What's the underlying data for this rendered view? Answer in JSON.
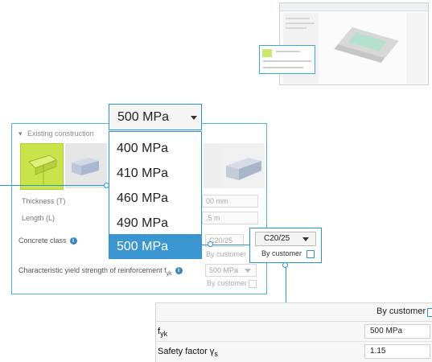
{
  "section": {
    "title": "Existing construction"
  },
  "fields": {
    "thickness_label": "Thickness (T)",
    "thickness_value": "00 mm",
    "length_label": "Length (L)",
    "length_value": ".5 m",
    "concrete_label": "Concrete class",
    "concrete_value": "C20/25",
    "concrete_by_customer": "By customer",
    "fyk_label_main": "Characteristic yield strength of reinforcement f",
    "fyk_label_sub": "yk",
    "fyk_value": "500 MPa",
    "fyk_by_customer": "By customer"
  },
  "dropdown": {
    "selected": "500 MPa",
    "options": [
      "400 MPa",
      "410 MPa",
      "460 MPa",
      "490 MPa",
      "500 MPa"
    ]
  },
  "concrete_popup": {
    "value": "C20/25",
    "by_customer": "By customer"
  },
  "zoom_panel": {
    "by_customer": "By customer",
    "fyk_label": "f",
    "fyk_sub": "yk",
    "fyk_value": "500 MPa",
    "safety_label": "Safety factor γ",
    "safety_sub": "s",
    "safety_value": "1.15"
  },
  "colors": {
    "accent": "#2e95cc",
    "selected_option": "#3b96d1",
    "tile_active": "#c9e34b"
  }
}
